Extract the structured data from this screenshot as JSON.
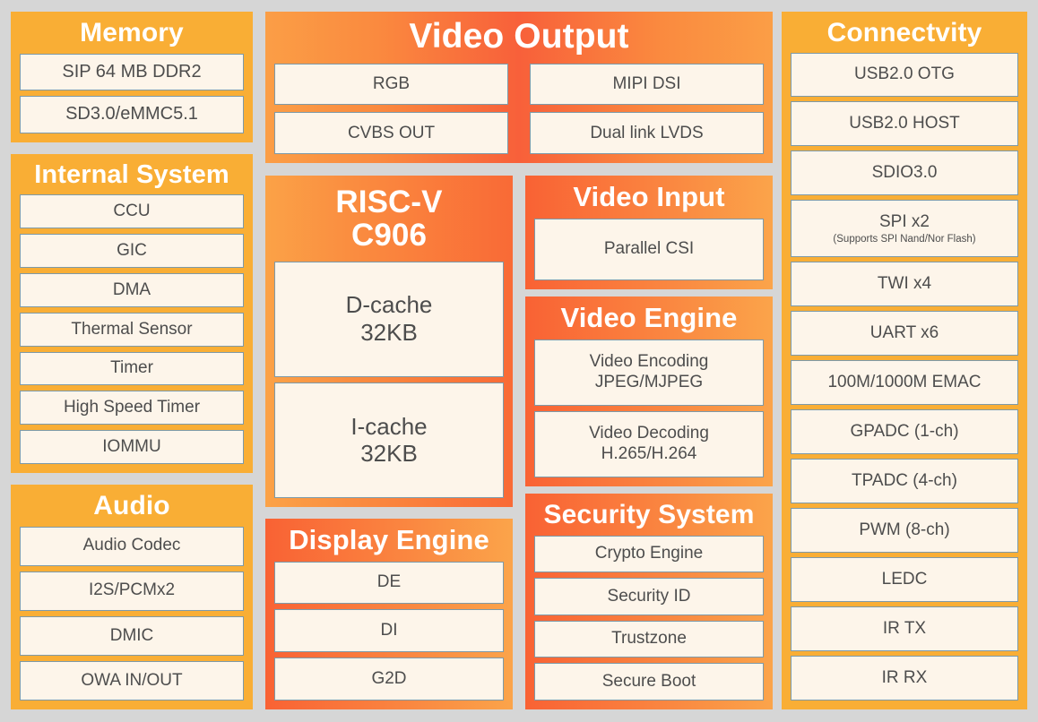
{
  "diagram": {
    "title": "SoC block diagram",
    "background_color": "#d6d6d6",
    "panel_color_flat": "#f9ae35",
    "panel_color_gradient_light": "#fba247",
    "panel_color_gradient_deep": "#f8603a",
    "box_fill": "#fdf5ea",
    "box_border": "#7d9aa9",
    "box_text": "#4d4d4d",
    "title_text": "#ffffff"
  },
  "panels": {
    "memory": {
      "title": "Memory",
      "items": [
        {
          "label": "SIP 64 MB DDR2"
        },
        {
          "label": "SD3.0/eMMC5.1"
        }
      ]
    },
    "internal_system": {
      "title": "Internal System",
      "items": [
        {
          "label": "CCU"
        },
        {
          "label": "GIC"
        },
        {
          "label": "DMA"
        },
        {
          "label": "Thermal Sensor"
        },
        {
          "label": "Timer"
        },
        {
          "label": "High Speed Timer"
        },
        {
          "label": "IOMMU"
        }
      ]
    },
    "audio": {
      "title": "Audio",
      "items": [
        {
          "label": "Audio Codec"
        },
        {
          "label": "I2S/PCMx2"
        },
        {
          "label": "DMIC"
        },
        {
          "label": "OWA IN/OUT"
        }
      ]
    },
    "video_output": {
      "title": "Video Output",
      "items": [
        {
          "label": "RGB"
        },
        {
          "label": "MIPI DSI"
        },
        {
          "label": "CVBS OUT"
        },
        {
          "label": "Dual link LVDS"
        }
      ]
    },
    "riscv": {
      "title": "RISC-V\nC906",
      "items": [
        {
          "label": "D-cache\n32KB"
        },
        {
          "label": "I-cache\n32KB"
        }
      ]
    },
    "display_engine": {
      "title": "Display Engine",
      "items": [
        {
          "label": "DE"
        },
        {
          "label": "DI"
        },
        {
          "label": "G2D"
        }
      ]
    },
    "video_input": {
      "title": "Video Input",
      "items": [
        {
          "label": "Parallel CSI"
        }
      ]
    },
    "video_engine": {
      "title": "Video Engine",
      "items": [
        {
          "label": "Video Encoding\nJPEG/MJPEG"
        },
        {
          "label": "Video Decoding\nH.265/H.264"
        }
      ]
    },
    "security_system": {
      "title": "Security System",
      "items": [
        {
          "label": "Crypto Engine"
        },
        {
          "label": "Security ID"
        },
        {
          "label": "Trustzone"
        },
        {
          "label": "Secure Boot"
        }
      ]
    },
    "connectivity": {
      "title": "Connectvity",
      "items": [
        {
          "label": "USB2.0 OTG"
        },
        {
          "label": "USB2.0 HOST"
        },
        {
          "label": "SDIO3.0"
        },
        {
          "label": "SPI x2",
          "sub": "(Supports SPI Nand/Nor Flash)"
        },
        {
          "label": "TWI x4"
        },
        {
          "label": "UART x6"
        },
        {
          "label": "100M/1000M EMAC"
        },
        {
          "label": "GPADC (1-ch)"
        },
        {
          "label": "TPADC (4-ch)"
        },
        {
          "label": "PWM (8-ch)"
        },
        {
          "label": "LEDC"
        },
        {
          "label": "IR TX"
        },
        {
          "label": "IR RX"
        }
      ]
    }
  }
}
